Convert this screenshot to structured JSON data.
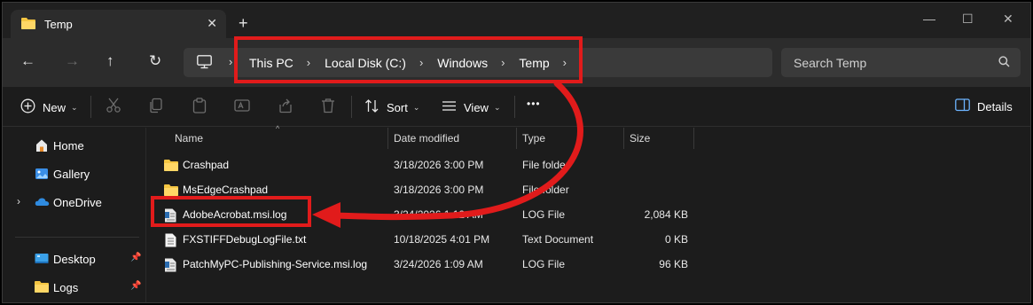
{
  "window": {
    "tab_title": "Temp",
    "new_tab_symbol": "+",
    "close_tab_symbol": "✕",
    "minimize_symbol": "—",
    "maximize_symbol": "☐",
    "close_symbol": "✕"
  },
  "nav": {
    "back_symbol": "←",
    "forward_symbol": "→",
    "up_symbol": "↑",
    "refresh_symbol": "↻"
  },
  "address": {
    "crumbs": [
      "This PC",
      "Local Disk (C:)",
      "Windows",
      "Temp"
    ],
    "separator": "›"
  },
  "search": {
    "placeholder": "Search Temp"
  },
  "toolbar": {
    "new_label": "New",
    "sort_label": "Sort",
    "view_label": "View",
    "more_label": "•••",
    "details_label": "Details",
    "caret": "⌄"
  },
  "sidebar": {
    "items": [
      {
        "label": "Home",
        "icon": "home-icon"
      },
      {
        "label": "Gallery",
        "icon": "gallery-icon"
      },
      {
        "label": "OneDrive",
        "icon": "onedrive-icon",
        "expander": "›"
      },
      {
        "label": "Desktop",
        "icon": "desktop-icon",
        "pin": "📌"
      },
      {
        "label": "Logs",
        "icon": "folder-icon",
        "pin": "📌"
      }
    ]
  },
  "columns": {
    "name": "Name",
    "date": "Date modified",
    "type": "Type",
    "size": "Size",
    "sort_indicator": "^"
  },
  "files": [
    {
      "name": "Crashpad",
      "date": "3/18/2026 3:00 PM",
      "type": "File folder",
      "size": "",
      "icon": "folder-icon"
    },
    {
      "name": "MsEdgeCrashpad",
      "date": "3/18/2026 3:00 PM",
      "type": "File folder",
      "size": "",
      "icon": "folder-icon"
    },
    {
      "name": "AdobeAcrobat.msi.log",
      "date": "3/24/2026 1:12 AM",
      "type": "LOG File",
      "size": "2,084 KB",
      "icon": "log-file-icon"
    },
    {
      "name": "FXSTIFFDebugLogFile.txt",
      "date": "10/18/2025 4:01 PM",
      "type": "Text Document",
      "size": "0 KB",
      "icon": "text-file-icon"
    },
    {
      "name": "PatchMyPC-Publishing-Service.msi.log",
      "date": "3/24/2026 1:09 AM",
      "type": "LOG File",
      "size": "96 KB",
      "icon": "log-file-icon"
    }
  ],
  "colors": {
    "annotation_red": "#e11b1b",
    "folder_yellow": "#f4c542",
    "background": "#1c1c1c"
  }
}
